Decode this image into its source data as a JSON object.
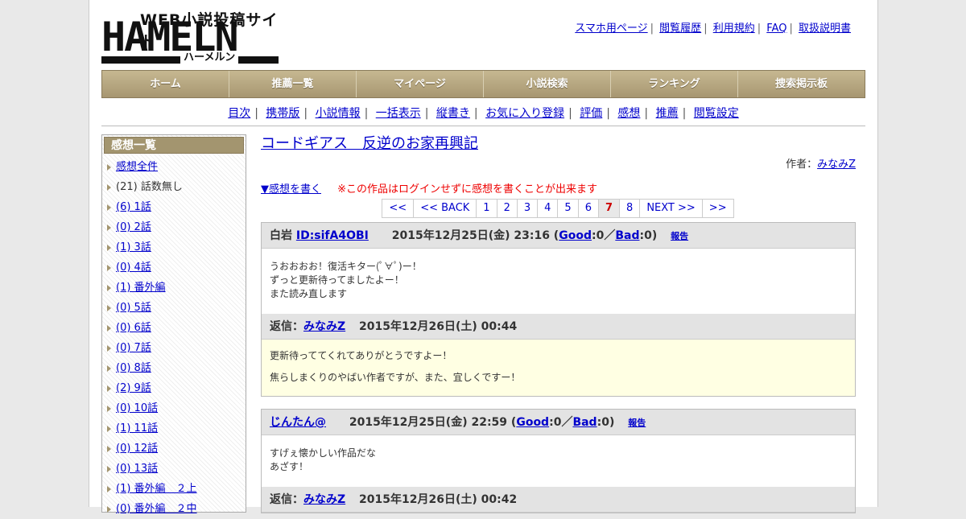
{
  "logo": {
    "subtitle": "WEB小説投稿サイト",
    "main": "HAMELN",
    "kana": "ハーメルン"
  },
  "toplinks": [
    "スマホ用ページ",
    "閲覧履歴",
    "利用規約",
    "FAQ",
    "取扱説明書"
  ],
  "mainnav": [
    "ホーム",
    "推薦一覧",
    "マイページ",
    "小説検索",
    "ランキング",
    "捜索掲示板"
  ],
  "subnav": [
    "目次",
    "携帯版",
    "小説情報",
    "一括表示",
    "縦書き",
    "お気に入り登録",
    "評価",
    "感想",
    "推薦",
    "閲覧設定"
  ],
  "sidebar": {
    "heading": "感想一覧",
    "items": [
      {
        "label": "感想全件",
        "link": true
      },
      {
        "label": "(21) 話数無し",
        "link": false
      },
      {
        "label": "(6) 1話",
        "link": true
      },
      {
        "label": "(0) 2話",
        "link": true
      },
      {
        "label": "(1) 3話",
        "link": true
      },
      {
        "label": "(0) 4話",
        "link": true
      },
      {
        "label": "(1) 番外編",
        "link": true
      },
      {
        "label": "(0) 5話",
        "link": true
      },
      {
        "label": "(0) 6話",
        "link": true
      },
      {
        "label": "(0) 7話",
        "link": true
      },
      {
        "label": "(0) 8話",
        "link": true
      },
      {
        "label": "(2) 9話",
        "link": true
      },
      {
        "label": "(0) 10話",
        "link": true
      },
      {
        "label": "(1) 11話",
        "link": true
      },
      {
        "label": "(0) 12話",
        "link": true
      },
      {
        "label": "(0) 13話",
        "link": true
      },
      {
        "label": "(1) 番外編　２上",
        "link": true
      },
      {
        "label": "(0) 番外編　２中",
        "link": true
      }
    ]
  },
  "main": {
    "title": "コードギアス　反逆のお家再興記",
    "author_label": "作者：",
    "author": "みなみZ",
    "write_link": "▼感想を書く",
    "write_note": "※この作品はログインせずに感想を書くことが出来ます",
    "pager": [
      {
        "label": "<<",
        "current": false
      },
      {
        "label": "<< BACK",
        "current": false
      },
      {
        "label": "1",
        "current": false
      },
      {
        "label": "2",
        "current": false
      },
      {
        "label": "3",
        "current": false
      },
      {
        "label": "4",
        "current": false
      },
      {
        "label": "5",
        "current": false
      },
      {
        "label": "6",
        "current": false
      },
      {
        "label": "7",
        "current": true
      },
      {
        "label": "8",
        "current": false
      },
      {
        "label": "NEXT >>",
        "current": false
      },
      {
        "label": ">>",
        "current": false
      }
    ],
    "comments": [
      {
        "name": "白岩",
        "id_link": "ID:sifA4OBI",
        "date": "2015年12月25日(金) 23:16",
        "good_label": "Good",
        "good": "0",
        "bad_label": "Bad",
        "bad": "0",
        "report": "報告",
        "body": [
          "うおおおお！復活キター(ﾟ∀ﾟ)ー！",
          "ずっと更新待ってましたよー！",
          "また読み直します"
        ],
        "reply_label": "返信：",
        "reply_author": "みなみZ",
        "reply_date": "2015年12月26日(土) 00:44",
        "reply_body": [
          "更新待っててくれてありがとうですよー！",
          "焦らしまくりのやばい作者ですが、また、宜しくですー！"
        ]
      },
      {
        "name_link": "じんたん@",
        "date": "2015年12月25日(金) 22:59",
        "good_label": "Good",
        "good": "0",
        "bad_label": "Bad",
        "bad": "0",
        "report": "報告",
        "body": [
          "すげぇ懐かしい作品だな",
          "あざす！"
        ],
        "reply_label": "返信：",
        "reply_author": "みなみZ",
        "reply_date": "2015年12月26日(土) 00:42"
      }
    ]
  },
  "colors": {
    "nav_bg": "#a79671",
    "link": "#0000cc",
    "note": "#ee0000",
    "reply_bg": "#ffffe3",
    "header_bg": "#e3e3e3"
  }
}
